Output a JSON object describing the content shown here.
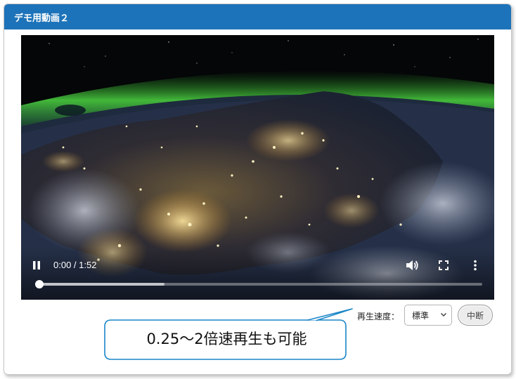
{
  "panel": {
    "title": "デモ用動画２"
  },
  "player": {
    "time_display": "0:00 / 1:52",
    "progress_fraction": 0.0,
    "buffered_fraction": 0.29,
    "icons": {
      "play": "pause-icon",
      "volume": "volume-icon",
      "fullscreen": "fullscreen-icon",
      "menu": "more-vert-icon"
    }
  },
  "speed": {
    "label": "再生速度：",
    "selected": "標準"
  },
  "stop_button": {
    "label": "中断"
  },
  "callout": {
    "text": "0.25〜2倍速再生も可能"
  },
  "colors": {
    "header_bg": "#1d73b9",
    "callout_border": "#1a86c8"
  }
}
